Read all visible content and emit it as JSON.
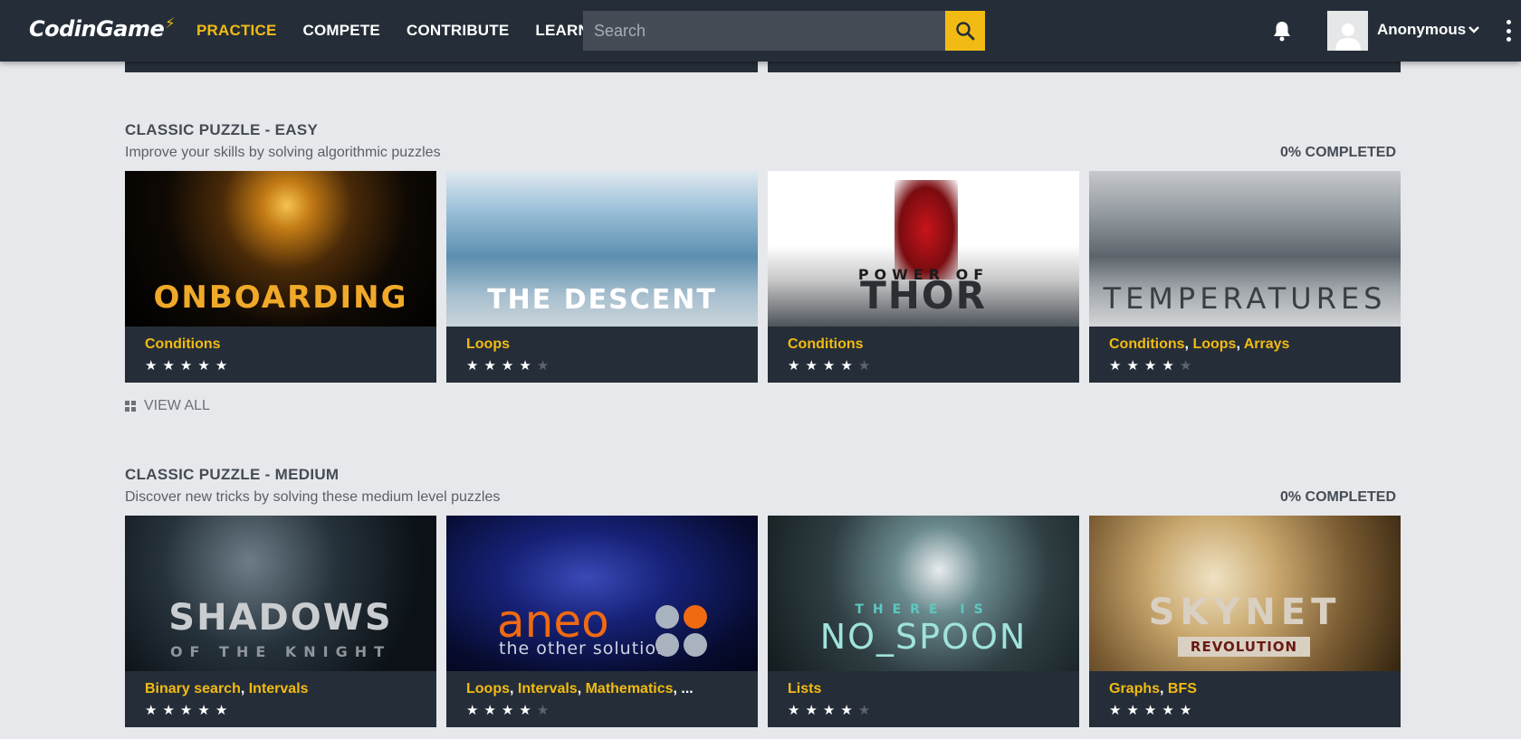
{
  "nav": {
    "logo": "CodinGame",
    "items": [
      "PRACTICE",
      "COMPETE",
      "CONTRIBUTE",
      "LEARN"
    ],
    "search_placeholder": "Search",
    "username": "Anonymous"
  },
  "sections": [
    {
      "title": "CLASSIC PUZZLE - EASY",
      "subtitle": "Improve your skills by solving algorithmic puzzles",
      "completed": "0% COMPLETED",
      "view_all": "VIEW ALL",
      "cards": [
        {
          "art_text": "ONBOARDING",
          "tags": [
            "Conditions"
          ],
          "rating": 5
        },
        {
          "art_text": "THE DESCENT",
          "tags": [
            "Loops"
          ],
          "rating": 4
        },
        {
          "art_text_top": "POWER OF",
          "art_text": "THOR",
          "tags": [
            "Conditions"
          ],
          "rating": 4
        },
        {
          "art_text": "TEMPERATURES",
          "tags": [
            "Conditions",
            "Loops",
            "Arrays"
          ],
          "rating": 4
        }
      ]
    },
    {
      "title": "CLASSIC PUZZLE - MEDIUM",
      "subtitle": "Discover new tricks by solving these medium level puzzles",
      "completed": "0% COMPLETED",
      "cards": [
        {
          "art_text": "SHADOWS",
          "art_text_sub": "OF THE KNIGHT",
          "tags": [
            "Binary search",
            "Intervals"
          ],
          "rating": 5
        },
        {
          "art_text": "aneo",
          "art_text_sub": "the other solution",
          "tags": [
            "Loops",
            "Intervals",
            "Mathematics",
            "..."
          ],
          "rating": 4
        },
        {
          "art_text_top": "THERE IS",
          "art_text": "NO_SPOON",
          "tags": [
            "Lists"
          ],
          "rating": 4
        },
        {
          "art_text": "SKYNET",
          "art_text_sub": "REVOLUTION",
          "tags": [
            "Graphs",
            "BFS"
          ],
          "rating": 5
        }
      ]
    }
  ],
  "colors": {
    "accent": "#f2bb13",
    "topbar": "#252e38",
    "background": "#e7e8eb",
    "card": "#252e38"
  }
}
